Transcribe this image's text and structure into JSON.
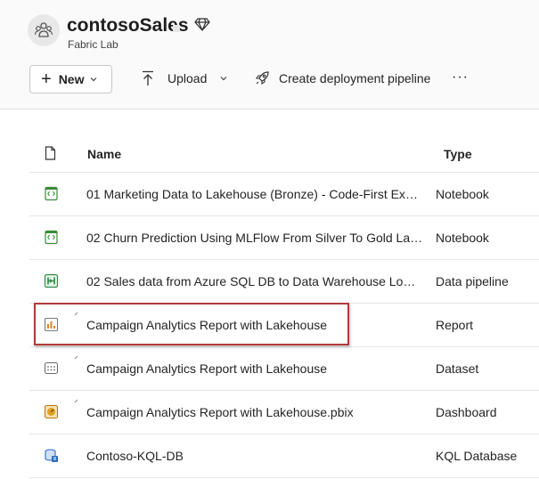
{
  "workspace": {
    "title": "contosoSales",
    "subtitle": "Fabric Lab"
  },
  "toolbar": {
    "new_label": "New",
    "upload_label": "Upload",
    "deploy_label": "Create deployment pipeline",
    "more_label": "···"
  },
  "table": {
    "headers": {
      "name": "Name",
      "type": "Type"
    },
    "rows": [
      {
        "name": "01 Marketing Data to Lakehouse (Bronze) - Code-First Expe...",
        "type": "Notebook",
        "icon": "notebook-icon"
      },
      {
        "name": "02 Churn Prediction Using MLFlow From Silver To Gold Layer",
        "type": "Notebook",
        "icon": "notebook-icon"
      },
      {
        "name": "02 Sales data from Azure SQL DB to Data Warehouse Low ...",
        "type": "Data pipeline",
        "icon": "data-pipeline-icon"
      },
      {
        "name": "Campaign Analytics Report with Lakehouse",
        "type": "Report",
        "icon": "report-icon"
      },
      {
        "name": "Campaign Analytics Report with Lakehouse",
        "type": "Dataset",
        "icon": "dataset-icon"
      },
      {
        "name": "Campaign Analytics Report with Lakehouse.pbix",
        "type": "Dashboard",
        "icon": "dashboard-icon"
      },
      {
        "name": "Contoso-KQL-DB",
        "type": "KQL Database",
        "icon": "kql-database-icon"
      }
    ]
  },
  "colors": {
    "highlight_border": "#b33a3a",
    "notebook_green": "#3a8a3a",
    "report_orange": "#d9822b",
    "kql_blue": "#2b6cc4"
  }
}
